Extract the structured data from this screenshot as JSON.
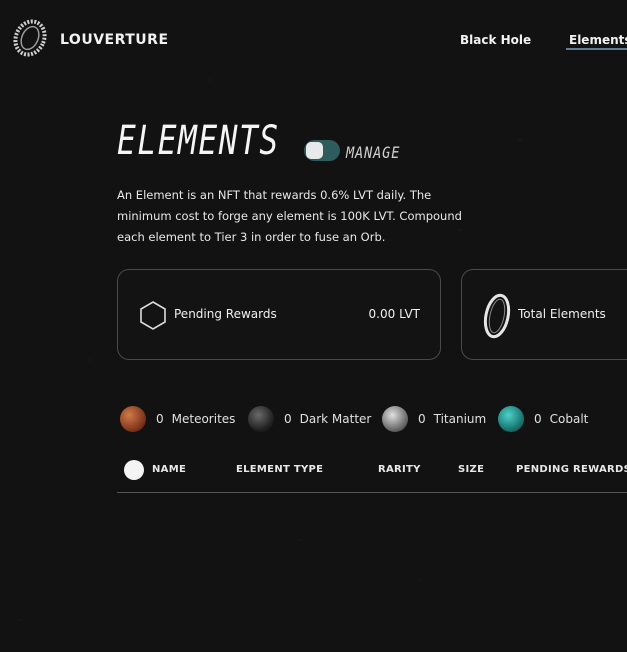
{
  "header": {
    "brand": "LOUVERTURE",
    "logo_icon": "ring-logo-icon",
    "nav": [
      {
        "label": "Black Hole"
      },
      {
        "label": "Elements",
        "active": true
      }
    ],
    "accent_underline": "#5f7d94"
  },
  "page": {
    "title": "ELEMENTS",
    "toggle_label": "MANAGE",
    "toggle_color": "#2e5b5b",
    "description": "An Element is an NFT that rewards 0.6% LVT daily. The minimum cost to forge any element is 100K LVT. Compound each element to Tier 3 in order to fuse an Orb."
  },
  "cards": {
    "pending": {
      "icon": "hexagon-icon",
      "label": "Pending Rewards",
      "value": "0.00 LVT"
    },
    "total": {
      "icon": "ring-icon",
      "label": "Total Elements"
    }
  },
  "stats": [
    {
      "icon": "meteorite-orb-icon",
      "count": "0",
      "label": "Meteorites",
      "color": "#9a4a2a"
    },
    {
      "icon": "dark-matter-orb-icon",
      "count": "0",
      "label": "Dark Matter",
      "color": "#2a2a2a"
    },
    {
      "icon": "titanium-orb-icon",
      "count": "0",
      "label": "Titanium",
      "color": "#8c8c8c"
    },
    {
      "icon": "cobalt-orb-icon",
      "count": "0",
      "label": "Cobalt",
      "color": "#1f8a86"
    }
  ],
  "table": {
    "columns": [
      "NAME",
      "ELEMENT TYPE",
      "RARITY",
      "SIZE",
      "PENDING REWARDS"
    ]
  }
}
